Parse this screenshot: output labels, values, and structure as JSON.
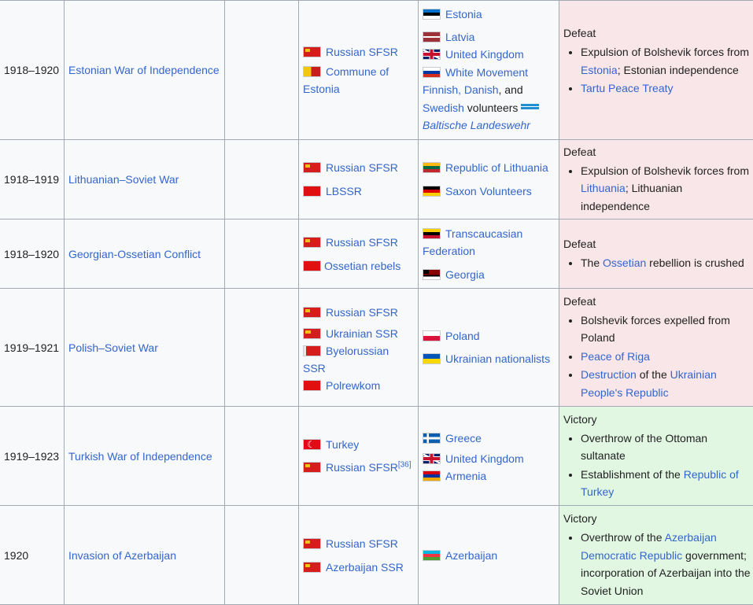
{
  "rows": [
    {
      "date": "1918–1920",
      "war": "Estonian War of Independence",
      "result_head": "Defeat",
      "result_class": "defeat"
    },
    {
      "date": "1918–1919",
      "war": "Lithuanian–Soviet War",
      "result_head": "Defeat",
      "result_class": "defeat"
    },
    {
      "date": "1918–1920",
      "war": "Georgian-Ossetian Conflict",
      "result_head": "Defeat",
      "result_class": "defeat"
    },
    {
      "date": "1919–1921",
      "war": "Polish–Soviet War",
      "result_head": "Defeat",
      "result_class": "defeat"
    },
    {
      "date": "1919–1923",
      "war": "Turkish War of Independence",
      "result_head": "Victory",
      "result_class": "victory"
    },
    {
      "date": "1920",
      "war": "Invasion of Azerbaijan",
      "result_head": "Victory",
      "result_class": "victory"
    }
  ],
  "r0": {
    "soviet": [
      "Russian SFSR",
      "Commune of Estonia"
    ],
    "opp": [
      "Estonia",
      "Latvia",
      "United Kingdom",
      "White Movement"
    ],
    "opp_finnish": "Finnish, Danish",
    "opp_and": ", and",
    "opp_swedish": "Swedish",
    "opp_volunteers": " volunteers",
    "opp_baltische": "Baltische Landeswehr",
    "b0a": "Expulsion of Bolshevik forces from ",
    "b0link": "Estonia",
    "b0b": "; Estonian independence",
    "b1link": "Tartu Peace Treaty"
  },
  "r1": {
    "soviet": [
      "Russian SFSR",
      "LBSSR"
    ],
    "opp": [
      "Republic of Lithuania",
      "Saxon Volunteers"
    ],
    "b0a": "Expulsion of Bolshevik forces from ",
    "b0link": "Lithuania",
    "b0b": "; Lithuanian independence"
  },
  "r2": {
    "soviet": [
      "Russian SFSR",
      "Ossetian rebels"
    ],
    "opp": [
      "Transcaucasian Federation",
      "Georgia"
    ],
    "b0a": "The ",
    "b0link": "Ossetian",
    "b0b": " rebellion is crushed"
  },
  "r3": {
    "soviet": [
      "Russian SFSR",
      "Ukrainian SSR",
      "Byelorussian SSR",
      "Polrewkom"
    ],
    "opp": [
      "Poland",
      "Ukrainian nationalists"
    ],
    "b0": "Bolshevik forces expelled from Poland",
    "b1link": "Peace of Riga",
    "b2link": "Destruction",
    "b2mid": " of the ",
    "b2link2": "Ukrainian People's Republic"
  },
  "r4": {
    "soviet": [
      "Turkey",
      "Russian SFSR"
    ],
    "soviet_ref": "[36]",
    "opp": [
      "Greece",
      "United Kingdom",
      "Armenia"
    ],
    "b0": "Overthrow of the Ottoman sultanate",
    "b1a": "Establishment of the ",
    "b1link": "Republic of Turkey"
  },
  "r5": {
    "soviet": [
      "Russian SFSR",
      "Azerbaijan SSR"
    ],
    "opp": [
      "Azerbaijan"
    ],
    "b0a": "Overthrow of the ",
    "b0link": "Azerbaijan Democratic Republic",
    "b0b": " government; incorporation of Azerbaijan into the Soviet Union"
  }
}
